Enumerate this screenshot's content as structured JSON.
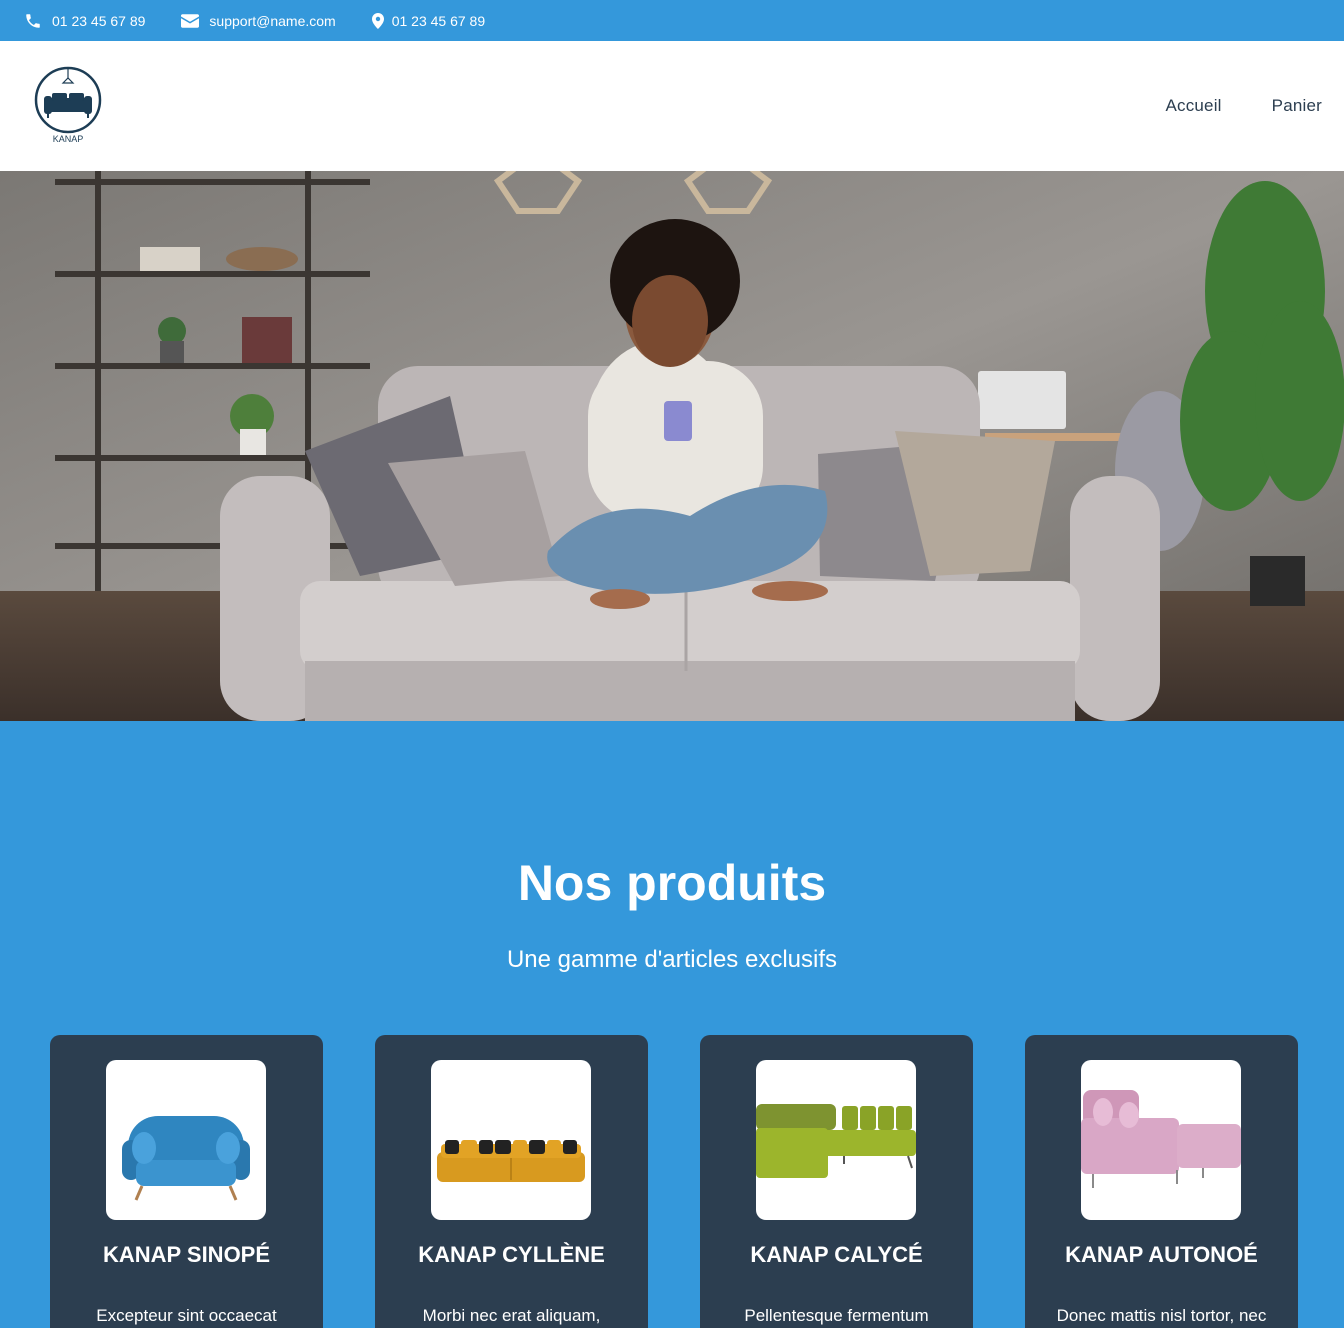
{
  "topbar": {
    "phone": "01 23 45 67 89",
    "email": "support@name.com",
    "address": "01 23 45 67 89",
    "background": "#3498db"
  },
  "header": {
    "logo_text": "KANAP",
    "nav": [
      {
        "label": "Accueil"
      },
      {
        "label": "Panier"
      }
    ]
  },
  "products": {
    "title": "Nos produits",
    "subtitle": "Une gamme d'articles exclusifs",
    "items": [
      {
        "name": "KANAP SINOPÉ",
        "description": "Excepteur sint occaecat",
        "color": "#2f86c0"
      },
      {
        "name": "KANAP CYLLÈNE",
        "description": "Morbi nec erat aliquam,",
        "color": "#e2a325"
      },
      {
        "name": "KANAP CALYCÉ",
        "description": "Pellentesque fermentum",
        "color": "#9cb52c"
      },
      {
        "name": "KANAP AUTONOÉ",
        "description": "Donec mattis nisl tortor, nec",
        "color": "#d9a7c6"
      }
    ]
  }
}
